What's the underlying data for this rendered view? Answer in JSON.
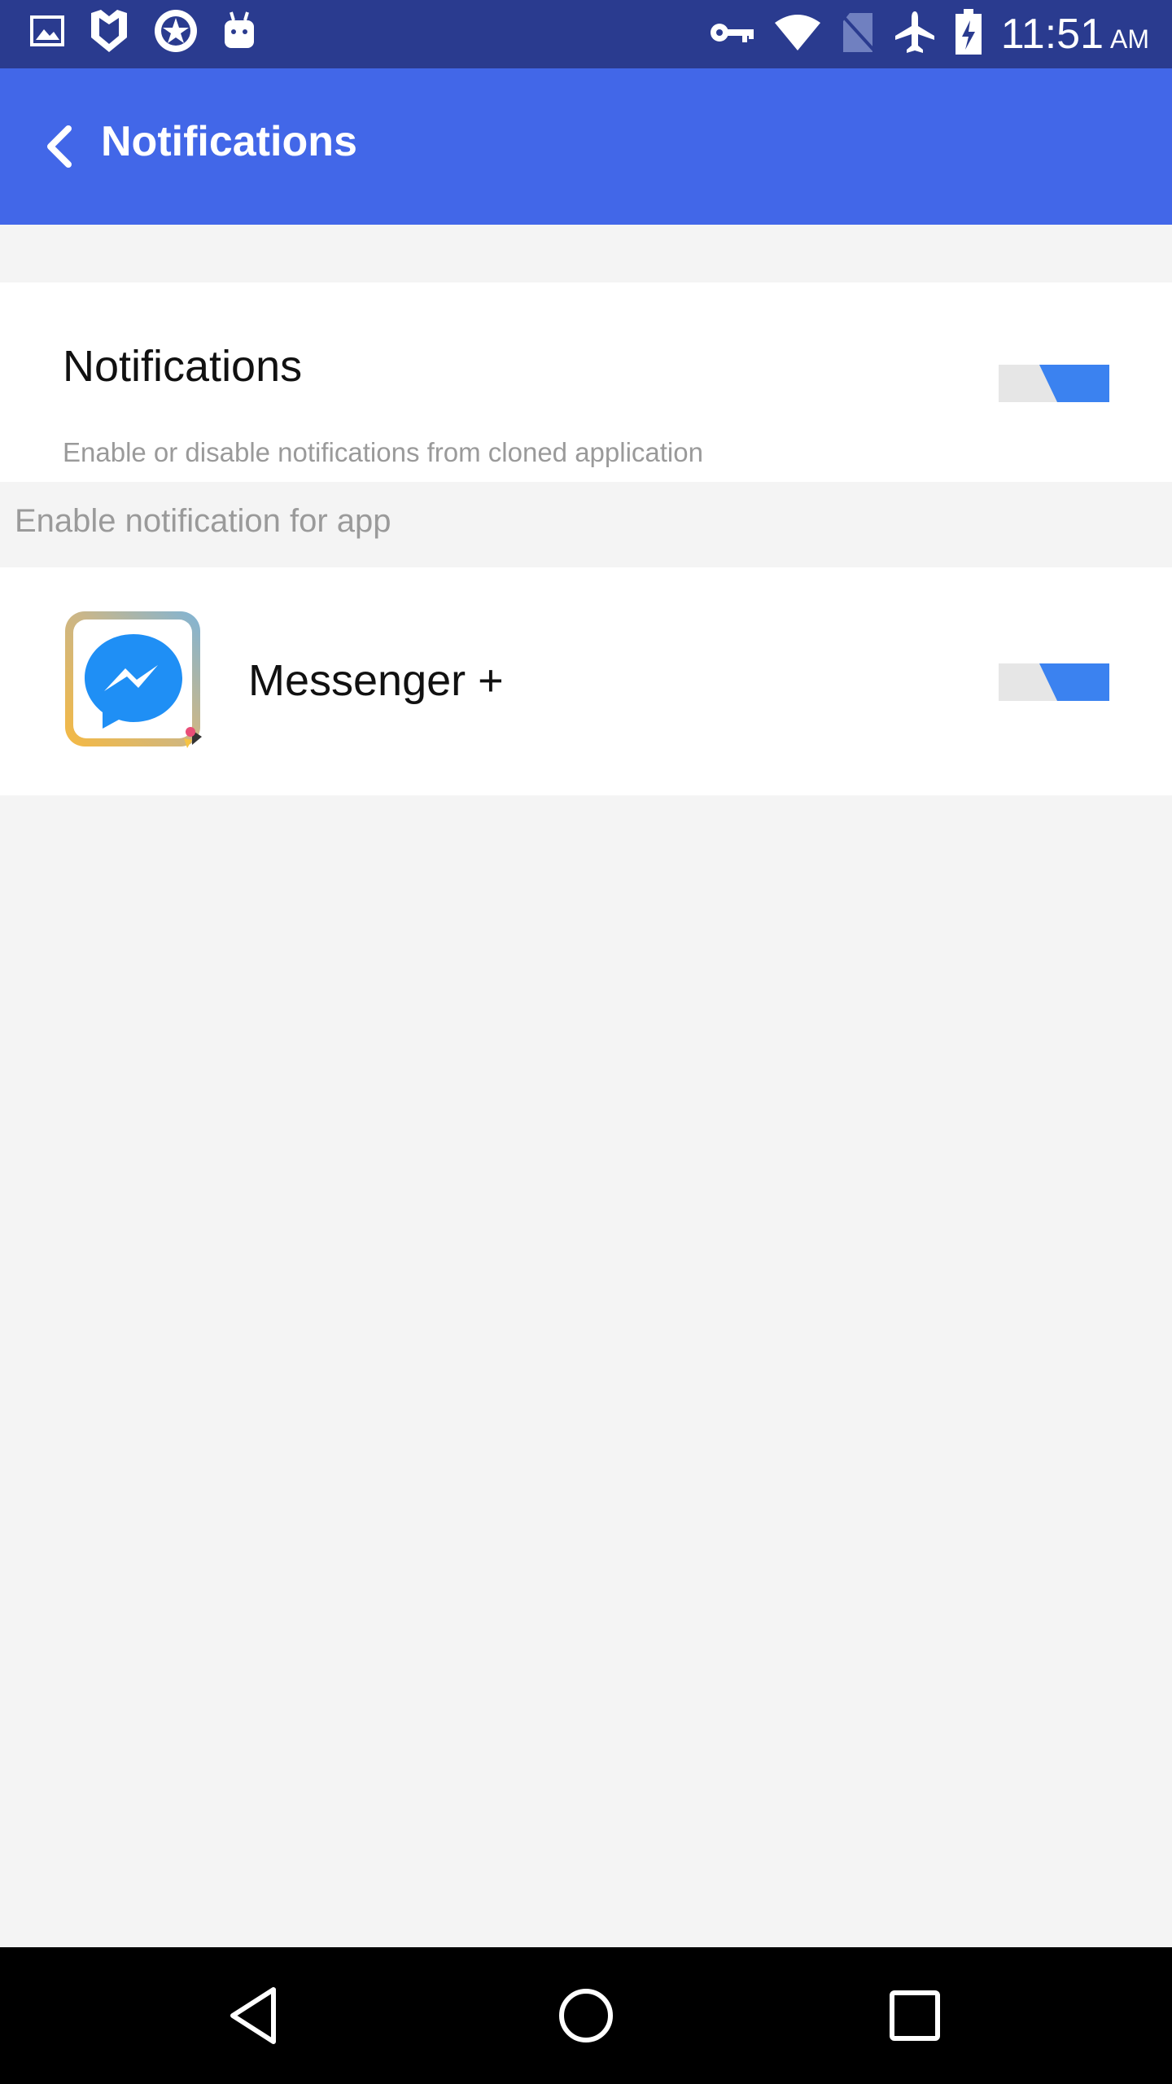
{
  "status_bar": {
    "time": "11:51",
    "ampm": "AM",
    "icons": [
      "image-icon",
      "shield-icon",
      "star-badge-icon",
      "android-icon",
      "key-icon",
      "wifi-icon",
      "no-sim-icon",
      "airplane-icon",
      "battery-charging-icon"
    ]
  },
  "app_bar": {
    "title": "Notifications",
    "back_icon": "chevron-left-icon",
    "color": "#4267e8"
  },
  "notifications_setting": {
    "title": "Notifications",
    "description": "Enable or disable notifications from cloned application",
    "enabled": true
  },
  "section": {
    "header": "Enable notification for app"
  },
  "apps": [
    {
      "name": "Messenger +",
      "icon": "messenger-icon",
      "enabled": true
    }
  ],
  "nav_bar": {
    "icons": [
      "back-triangle-icon",
      "home-circle-icon",
      "recents-square-icon"
    ]
  },
  "colors": {
    "accent": "#3b82f0",
    "toggle_track": "#e6e6e6",
    "status_bar": "#2a3b8f"
  }
}
